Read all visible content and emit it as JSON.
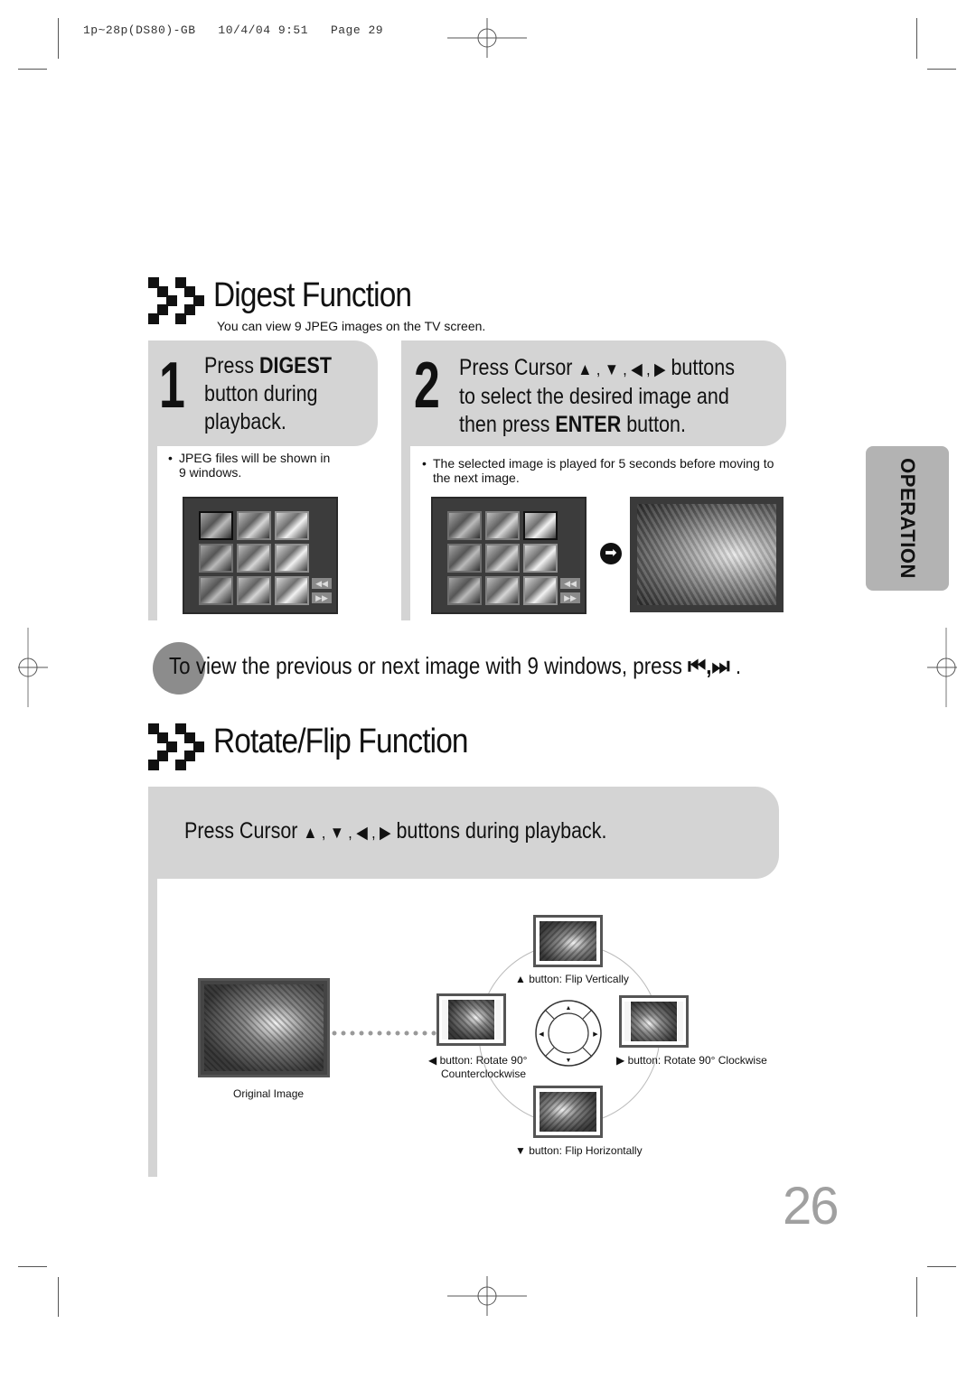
{
  "print_header": "1p~28p(DS80)-GB   10/4/04 9:51   Page 29",
  "digest": {
    "title": "Digest Function",
    "subtitle": "You can view 9 JPEG images on the TV screen.",
    "step1": {
      "number": "1",
      "line1_pre": "Press ",
      "line1_bold": "DIGEST",
      "line2": "button during",
      "line3": "playback.",
      "note_line1": "JPEG files will be shown in",
      "note_line2": "9 windows."
    },
    "step2": {
      "number": "2",
      "line1_pre": "Press Cursor ",
      "arrows": "▲ , ▼ , ◀ , ▶",
      "line1_post": " buttons",
      "line2": "to select the desired image and",
      "line3_pre": "then press ",
      "line3_bold": "ENTER",
      "line3_post": " button.",
      "note_line1": "The selected image is played for 5 seconds before moving to",
      "note_line2": "the next image."
    },
    "grid_nav": {
      "prev": "◀◀",
      "next": "▶▶"
    },
    "screen1_selected_index": 0,
    "screen2_selected_index": 2,
    "arrow_icon": "➡"
  },
  "side_tab": {
    "label": "OPERATION"
  },
  "tip": {
    "text": "To view the previous or next image with 9 windows, press",
    "skip_icons": "⏮,⏭",
    "end": " ."
  },
  "rotate": {
    "title": "Rotate/Flip Function",
    "instruction_pre": "Press Cursor ",
    "arrows": "▲ , ▼ , ◀ , ▶",
    "instruction_post": "  buttons during playback.",
    "original_caption": "Original Image",
    "up_caption": "▲ button: Flip Vertically",
    "left_caption_line1": "◀ button: Rotate 90°",
    "left_caption_line2": "Counterclockwise",
    "right_caption": "▶ button: Rotate 90° Clockwise",
    "down_caption": "▼ button: Flip Horizontally",
    "dpad": {
      "up": "▲",
      "down": "▼",
      "left": "◀",
      "right": "▶"
    }
  },
  "page_number": "26"
}
